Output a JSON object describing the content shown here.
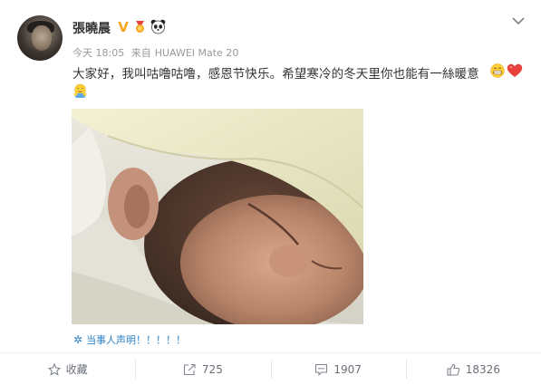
{
  "user": {
    "name": "張曉晨",
    "verified_badge": "V",
    "badges": [
      "medal-icon",
      "panda-icon"
    ]
  },
  "meta": {
    "time": "今天 18:05",
    "source_prefix": "来自",
    "source": "HUAWEI Mate 20"
  },
  "post": {
    "text": "大家好，我叫咕噜咕噜，感恩节快乐。希望寒冷的冬天里你也能有一絲暖意",
    "emojis": [
      "grin-emoji",
      "heart-emoji",
      "hug-emoji"
    ]
  },
  "notice": {
    "icon": "snowflake-icon",
    "text": "当事人声明！！！！！"
  },
  "actions": {
    "favorite_label": "收藏",
    "repost_count": "725",
    "comment_count": "1907",
    "like_count": "18326"
  },
  "colors": {
    "link_blue": "#2d82c6",
    "verified_orange": "#f6a623",
    "heart_red": "#e8403a",
    "muted_text": "#999999"
  }
}
